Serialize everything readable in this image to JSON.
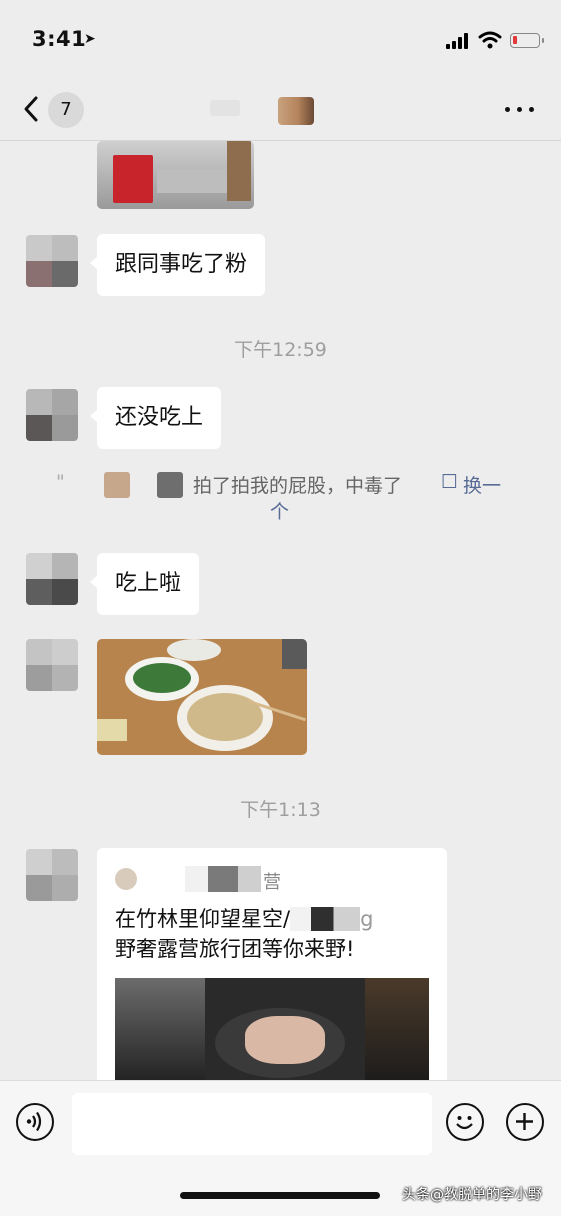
{
  "status_bar": {
    "time": "3:41",
    "battery_color": "#e23a3a"
  },
  "nav": {
    "unread_count": "7",
    "back_icon": "chevron-left-icon",
    "more_icon": "ellipsis-icon"
  },
  "messages": {
    "msg1": "跟同事吃了粉",
    "time1": "下午12:59",
    "msg2": "还没吃上",
    "pat_text": "拍了拍我的屁股，中毒了",
    "pat_action_1": "换一",
    "pat_action_2": "个",
    "msg3": "吃上啦",
    "time2": "下午1:13"
  },
  "share_card": {
    "source_suffix": "营",
    "title_line1": "在竹林里仰望星空/",
    "title_line1_end": "g",
    "title_line2": "野奢露营旅行团等你来野!"
  },
  "watermark": "头条@教脱单的李小野",
  "colors": {
    "background": "#ededed",
    "bubble": "#ffffff",
    "timestamp": "#9e9e9e",
    "link": "#576b95"
  }
}
